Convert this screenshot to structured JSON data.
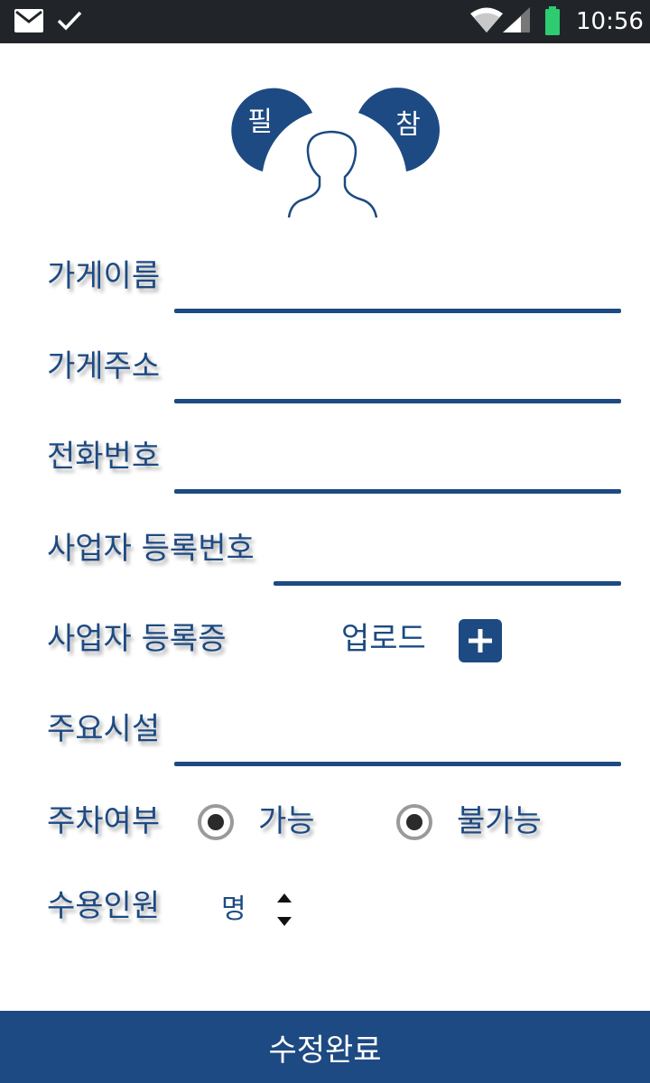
{
  "status_bar": {
    "time": "10:56"
  },
  "profile_badges": {
    "left": "필",
    "right": "참"
  },
  "form": {
    "store_name": {
      "label": "가게이름",
      "value": ""
    },
    "store_address": {
      "label": "가게주소",
      "value": ""
    },
    "phone": {
      "label": "전화번호",
      "value": ""
    },
    "business_reg_number": {
      "label": "사업자 등록번호",
      "value": ""
    },
    "business_reg_cert": {
      "label": "사업자 등록증",
      "upload_label": "업로드"
    },
    "main_facilities": {
      "label": "주요시설",
      "value": ""
    },
    "parking": {
      "label": "주차여부",
      "options": [
        "가능",
        "불가능"
      ]
    },
    "capacity": {
      "label": "수용인원",
      "value": "",
      "unit": "명"
    }
  },
  "submit_label": "수정완료",
  "colors": {
    "primary": "#1d4a82",
    "status_bar": "#212529",
    "battery": "#2ecc71"
  }
}
